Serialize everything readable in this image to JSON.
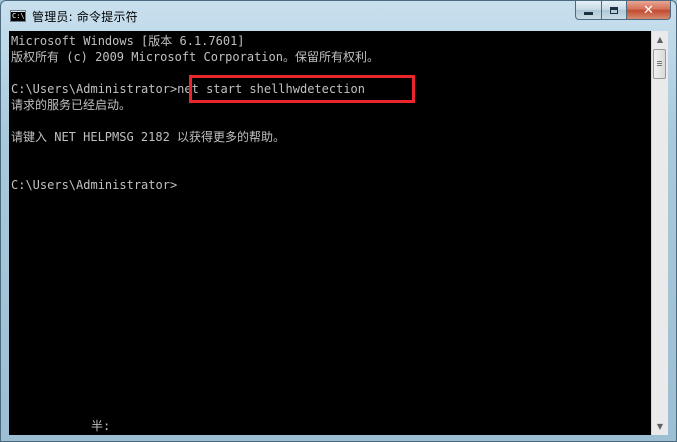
{
  "window": {
    "title": "管理员: 命令提示符",
    "icon": "cmd-icon",
    "icon_text": "C:\\"
  },
  "caption_buttons": {
    "minimize": "minimize-icon",
    "maximize": "maximize-icon",
    "close_label": "✕"
  },
  "console": {
    "lines": [
      "Microsoft Windows [版本 6.1.7601]",
      "版权所有 (c) 2009 Microsoft Corporation。保留所有权利。",
      "",
      "C:\\Users\\Administrator>net start shellhwdetection",
      "请求的服务已经启动。",
      "",
      "请键入 NET HELPMSG 2182 以获得更多的帮助。",
      "",
      "",
      "C:\\Users\\Administrator>"
    ],
    "ime_status": "半:",
    "highlight_color": "#e8262b"
  },
  "scrollbar": {
    "up_arrow": "▲",
    "down_arrow": "▼"
  }
}
